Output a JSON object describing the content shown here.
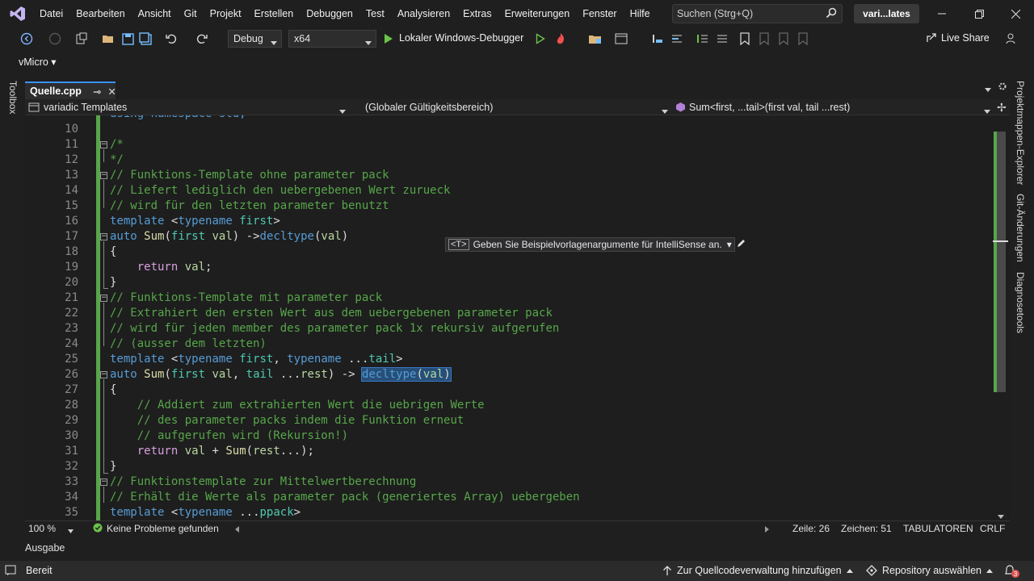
{
  "menu": [
    "Datei",
    "Bearbeiten",
    "Ansicht",
    "Git",
    "Projekt",
    "Erstellen",
    "Debuggen",
    "Test",
    "Analysieren",
    "Extras",
    "Erweiterungen",
    "Fenster",
    "Hilfe"
  ],
  "search": {
    "placeholder": "Suchen (Strg+Q)"
  },
  "solution_badge": "vari...lates",
  "toolbar": {
    "config": "Debug",
    "platform": "x64",
    "run_label": "Lokaler Windows-Debugger",
    "live_share": "Live Share"
  },
  "vmicro": "vMicro",
  "side": {
    "toolbox": "Toolbox",
    "right_panels": [
      "Projektmappen-Explorer",
      "Git-Änderungen",
      "Diagnosetools"
    ]
  },
  "tab": {
    "label": "Quelle.cpp"
  },
  "nav": {
    "project": "variadic Templates",
    "scope": "(Globaler Gültigkeitsbereich)",
    "member": "Sum<first, ...tail>(first val, tail ...rest)"
  },
  "editor": {
    "partial_top_line": "using namespace std;",
    "lines": [
      {
        "n": "10",
        "t": ""
      },
      {
        "n": "11",
        "t": "/*"
      },
      {
        "n": "12",
        "t": "*/"
      },
      {
        "n": "13",
        "t": "// Funktions-Template ohne parameter pack"
      },
      {
        "n": "14",
        "t": "// Liefert lediglich den uebergebenen Wert zurueck"
      },
      {
        "n": "15",
        "t": "// wird für den letzten parameter benutzt"
      },
      {
        "n": "16",
        "t": "template <typename first>"
      },
      {
        "n": "17",
        "t": "auto Sum(first val) ->decltype(val)"
      },
      {
        "n": "18",
        "t": "{"
      },
      {
        "n": "19",
        "t": "    return val;"
      },
      {
        "n": "20",
        "t": "}"
      },
      {
        "n": "21",
        "t": "// Funktions-Template mit parameter pack"
      },
      {
        "n": "22",
        "t": "// Extrahiert den ersten Wert aus dem uebergebenen parameter pack"
      },
      {
        "n": "23",
        "t": "// wird für jeden member des parameter pack 1x rekursiv aufgerufen"
      },
      {
        "n": "24",
        "t": "// (ausser dem letzten)"
      },
      {
        "n": "25",
        "t": "template <typename first, typename ...tail>"
      },
      {
        "n": "26",
        "t": "auto Sum(first val, tail ...rest) -> decltype(val)"
      },
      {
        "n": "27",
        "t": "{"
      },
      {
        "n": "28",
        "t": "    // Addiert zum extrahierten Wert die uebrigen Werte"
      },
      {
        "n": "29",
        "t": "    // des parameter packs indem die Funktion erneut"
      },
      {
        "n": "30",
        "t": "    // aufgerufen wird (Rekursion!)"
      },
      {
        "n": "31",
        "t": "    return val + Sum(rest...);"
      },
      {
        "n": "32",
        "t": "}"
      },
      {
        "n": "33",
        "t": "// Funktionstemplate zur Mittelwertberechnung"
      },
      {
        "n": "34",
        "t": "// Erhält die Werte als parameter pack (generiertes Array) uebergeben"
      },
      {
        "n": "35",
        "t": "template <typename ...ppack>"
      }
    ],
    "hint": {
      "badge": "<T>",
      "text": "Geben Sie Beispielvorlagenargumente für IntelliSense an."
    }
  },
  "editor_status": {
    "zoom": "100 %",
    "problems": "Keine Probleme gefunden",
    "line": "Zeile: 26",
    "col": "Zeichen: 51",
    "tabs": "TABULATOREN",
    "eol": "CRLF"
  },
  "output_tab": "Ausgabe",
  "statusbar": {
    "ready": "Bereit",
    "source_control": "Zur Quellcodeverwaltung hinzufügen",
    "repo": "Repository auswählen",
    "notifications": "3"
  },
  "colors": {
    "comment": "#57a64a",
    "keyword": "#569cd6",
    "type": "#4ec9b0",
    "control": "#d8a0df",
    "function": "#dcdcaa",
    "accent": "#3794ff"
  }
}
